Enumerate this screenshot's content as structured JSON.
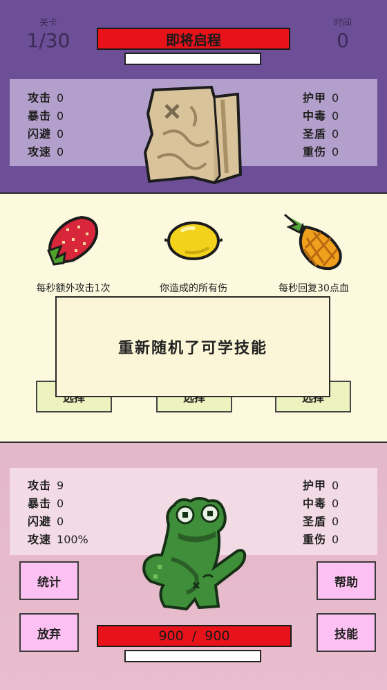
{
  "enemy": {
    "level_label": "关卡",
    "level_value": "1/30",
    "time_label": "时间",
    "time_value": "0",
    "title": "即将启程",
    "stats_left": [
      {
        "label": "攻击",
        "value": "0"
      },
      {
        "label": "暴击",
        "value": "0"
      },
      {
        "label": "闪避",
        "value": "0"
      },
      {
        "label": "攻速",
        "value": "0"
      }
    ],
    "stats_right": [
      {
        "label": "护甲",
        "value": "0"
      },
      {
        "label": "中毒",
        "value": "0"
      },
      {
        "label": "圣盾",
        "value": "0"
      },
      {
        "label": "重伤",
        "value": "0"
      }
    ],
    "portrait_icon": "treasure-map-icon"
  },
  "skills": {
    "options": [
      {
        "icon": "strawberry-icon",
        "desc": "每秒额外攻击1次",
        "button": "选择"
      },
      {
        "icon": "lemon-icon",
        "desc": "你造成的所有伤",
        "button": "选择"
      },
      {
        "icon": "pineapple-icon",
        "desc": "每秒回复30点血",
        "button": "选择"
      }
    ],
    "popup_message": "重新随机了可学技能"
  },
  "player": {
    "stats_left": [
      {
        "label": "攻击",
        "value": "9"
      },
      {
        "label": "暴击",
        "value": "0"
      },
      {
        "label": "闪避",
        "value": "0"
      },
      {
        "label": "攻速",
        "value": "100%"
      }
    ],
    "stats_right": [
      {
        "label": "护甲",
        "value": "0"
      },
      {
        "label": "中毒",
        "value": "0"
      },
      {
        "label": "圣盾",
        "value": "0"
      },
      {
        "label": "重伤",
        "value": "0"
      }
    ],
    "hp_text": "900  /  900",
    "hp_fraction": 1.0,
    "portrait_icon": "frog-icon",
    "buttons": {
      "stats": "统计",
      "give_up": "放弃",
      "help": "帮助",
      "skills": "技能"
    }
  },
  "colors": {
    "top_bg": "#6c4f96",
    "bar_red": "#e8121b",
    "panel_cream": "#fcf9df",
    "button_pink": "#fcc1f2"
  }
}
